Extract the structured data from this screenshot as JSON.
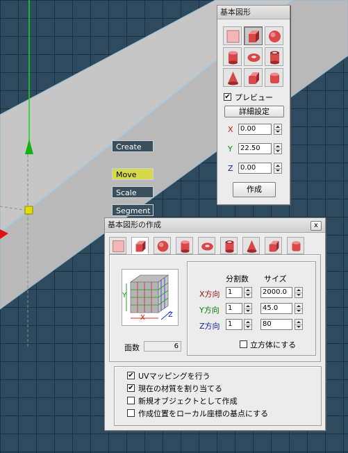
{
  "viewport": {
    "buttons": [
      {
        "id": "create",
        "label": "Create",
        "active": false
      },
      {
        "id": "move",
        "label": "Move",
        "active": true
      },
      {
        "id": "scale",
        "label": "Scale",
        "active": false
      },
      {
        "id": "segment",
        "label": "Segment",
        "active": false
      }
    ]
  },
  "small_panel": {
    "title": "基本図形",
    "shapes": [
      "plane-icon",
      "cube-icon",
      "sphere-icon",
      "cylinder-icon",
      "torus-icon",
      "tube-icon",
      "cone-icon",
      "rounded-cube-icon",
      "rounded-cylinder-icon"
    ],
    "selected_shape": 1,
    "preview": {
      "label": "プレビュー",
      "checked": true
    },
    "details_button": "詳細設定",
    "x": {
      "label": "X",
      "value": "0.00"
    },
    "y": {
      "label": "Y",
      "value": "22.50"
    },
    "z": {
      "label": "Z",
      "value": "0.00"
    },
    "create_button": "作成",
    "axis_colors": {
      "x": "#d01010",
      "y": "#0a8a0a",
      "z": "#1020c0"
    }
  },
  "dialog": {
    "title": "基本図形の作成",
    "close_label": "x",
    "selected_tab": 1,
    "preview_axis_labels": {
      "y": "Y",
      "x": "X",
      "z": "Z"
    },
    "face_count": {
      "label": "面数",
      "value": "6"
    },
    "col_headers": {
      "divisions": "分割数",
      "size": "サイズ"
    },
    "rows": [
      {
        "label": "X方向",
        "div": "1",
        "size": "2000.0",
        "color": "#a01010"
      },
      {
        "label": "Y方向",
        "div": "1",
        "size": "45.0",
        "color": "#0a7a0a"
      },
      {
        "label": "Z方向",
        "div": "1",
        "size": "80",
        "color": "#1020a0"
      }
    ],
    "cube_option": {
      "label": "立方体にする",
      "checked": false
    },
    "options": [
      {
        "label": "UVマッピングを行う",
        "checked": true
      },
      {
        "label": "現在の材質を割り当てる",
        "checked": true
      },
      {
        "label": "新規オブジェクトとして作成",
        "checked": false
      },
      {
        "label": "作成位置をローカル座標の基点にする",
        "checked": false
      }
    ]
  }
}
